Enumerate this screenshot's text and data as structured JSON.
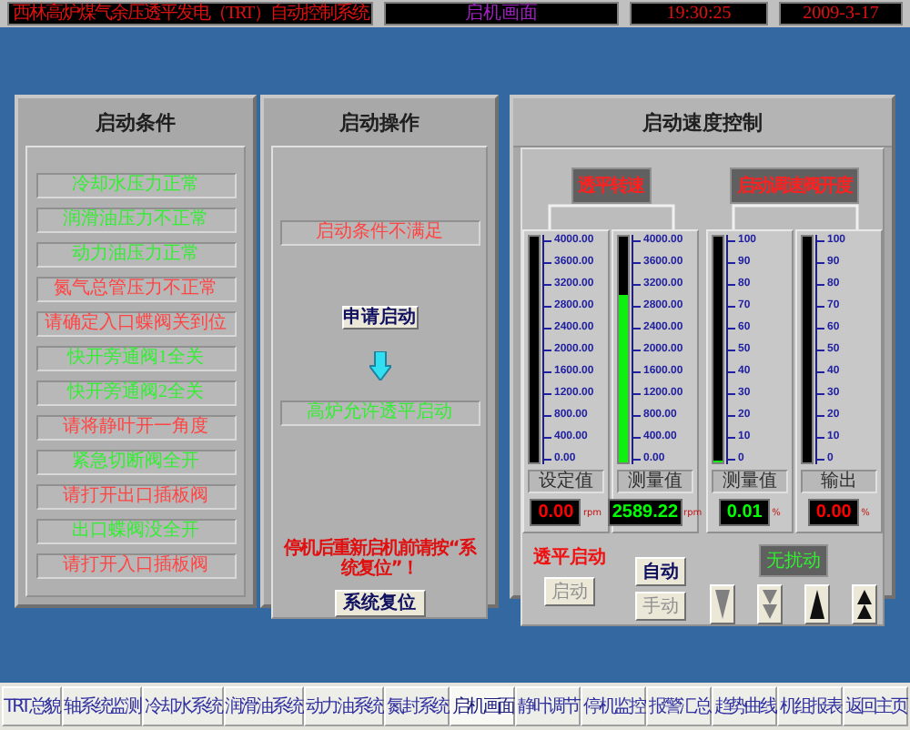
{
  "header": {
    "system_title": "西林高炉煤气余压透平发电（TRT）自动控制系统",
    "screen_title": "启机画面",
    "time": "19:30:25",
    "date": "2009-3-17"
  },
  "conditions": {
    "title": "启动条件",
    "items": [
      {
        "text": "冷却水压力正常",
        "color": "#33ee33"
      },
      {
        "text": "润滑油压力不正常",
        "color": "#33ee33"
      },
      {
        "text": "动力油压力正常",
        "color": "#33ee33"
      },
      {
        "text": "氮气总管压力不正常",
        "color": "#ff4444"
      },
      {
        "text": "请确定入口蝶阀关到位",
        "color": "#ff4444"
      },
      {
        "text": "快开旁通阀1全关",
        "color": "#33ee33"
      },
      {
        "text": "快开旁通阀2全关",
        "color": "#33ee33"
      },
      {
        "text": "请将静叶开一角度",
        "color": "#ff4444"
      },
      {
        "text": "紧急切断阀全开",
        "color": "#33ee33"
      },
      {
        "text": "请打开出口插板阀",
        "color": "#ff4444"
      },
      {
        "text": "出口蝶阀没全开",
        "color": "#33ee33"
      },
      {
        "text": "请打开入口插板阀",
        "color": "#ff4444"
      }
    ]
  },
  "operation": {
    "title": "启动操作",
    "condition_status": {
      "text": "启动条件不满足",
      "color": "#ff4444"
    },
    "request_button": "申请启动",
    "permit_status": {
      "text": "高炉允许透平启动",
      "color": "#33ee33"
    },
    "reset_notice": "停机后重新启机前请按“系统复位”！",
    "reset_button": "系统复位"
  },
  "speed_control": {
    "title": "启动速度控制",
    "groups": [
      {
        "label": "透平转速",
        "gauges": [
          {
            "scale": [
              "4000.00",
              "3600.00",
              "3200.00",
              "2800.00",
              "2400.00",
              "2000.00",
              "1600.00",
              "1200.00",
              "800.00",
              "400.00",
              "0.00"
            ],
            "level": 0,
            "label": "设定值",
            "reading": "0.00",
            "unit": "rpm",
            "color": "#ff0000"
          },
          {
            "scale": [
              "4000.00",
              "3600.00",
              "3200.00",
              "2800.00",
              "2400.00",
              "2000.00",
              "1600.00",
              "1200.00",
              "800.00",
              "400.00",
              "0.00"
            ],
            "level": 0.74,
            "label": "测量值",
            "reading": "2589.22",
            "unit": "rpm",
            "color": "#00ff00"
          }
        ]
      },
      {
        "label": "启动调速阀开度",
        "gauges": [
          {
            "scale": [
              "100",
              "90",
              "80",
              "70",
              "60",
              "50",
              "40",
              "30",
              "20",
              "10",
              "0"
            ],
            "level": 0.01,
            "label": "测量值",
            "reading": "0.01",
            "unit": "%",
            "color": "#00ff00"
          },
          {
            "scale": [
              "100",
              "90",
              "80",
              "70",
              "60",
              "50",
              "40",
              "30",
              "20",
              "10",
              "0"
            ],
            "level": 0,
            "label": "输出",
            "reading": "0.00",
            "unit": "%",
            "color": "#ff0000"
          }
        ]
      }
    ],
    "start_label": "透平启动",
    "start_button": {
      "label": "启动",
      "disabled": true
    },
    "mode_buttons": [
      {
        "label": "自动",
        "disabled": false
      },
      {
        "label": "手动",
        "disabled": true
      }
    ],
    "indicator": "无扰动",
    "step_buttons": [
      {
        "kind": "down",
        "disabled": true
      },
      {
        "kind": "double-down",
        "disabled": true
      },
      {
        "kind": "up",
        "disabled": false
      },
      {
        "kind": "double-up",
        "disabled": false
      }
    ]
  },
  "nav": [
    {
      "label": "TRT总貌",
      "selected": false
    },
    {
      "label": "轴系统监测",
      "selected": false
    },
    {
      "label": "冷却水系统",
      "selected": false
    },
    {
      "label": "润滑油系统",
      "selected": false
    },
    {
      "label": "动力油系统",
      "selected": false
    },
    {
      "label": "氮封系统",
      "selected": false
    },
    {
      "label": "启机画面",
      "selected": true
    },
    {
      "label": "静叶调节",
      "selected": false
    },
    {
      "label": "停机监控",
      "selected": false
    },
    {
      "label": "报警汇总",
      "selected": false
    },
    {
      "label": "趋势曲线",
      "selected": false
    },
    {
      "label": "机组报表",
      "selected": false
    },
    {
      "label": "返回主页",
      "selected": false
    }
  ]
}
